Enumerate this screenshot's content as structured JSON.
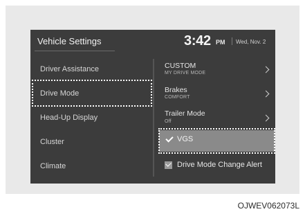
{
  "header": {
    "title": "Vehicle Settings",
    "time": "3:42",
    "ampm": "PM",
    "date": "Wed, Nov. 2"
  },
  "left_menu": [
    {
      "label": "Driver Assistance"
    },
    {
      "label": "Drive Mode",
      "selected": true
    },
    {
      "label": "Head-Up Display"
    },
    {
      "label": "Cluster"
    },
    {
      "label": "Climate"
    }
  ],
  "right_menu": {
    "items": [
      {
        "title": "CUSTOM",
        "subtitle": "MY DRIVE MODE"
      },
      {
        "title": "Brakes",
        "subtitle": "COMFORT"
      },
      {
        "title": "Trailer Mode",
        "subtitle": "Off"
      }
    ],
    "vgs": {
      "label": "VGS",
      "checked": true,
      "highlighted": true
    },
    "alert": {
      "label": "Drive Mode Change Alert",
      "checked": true
    }
  },
  "figure_code": "OJWEV062073L",
  "colors": {
    "screen_bg": "#3c3c3c",
    "highlight_bg": "#8a8a8a",
    "frame_bg": "#e9e9e9"
  }
}
